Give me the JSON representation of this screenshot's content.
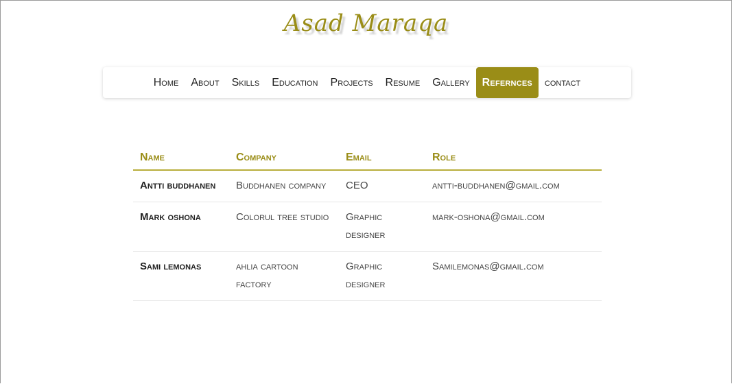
{
  "site": {
    "logo_text": "Asad Maraqa"
  },
  "nav": {
    "items": [
      {
        "label": "Home"
      },
      {
        "label": "About"
      },
      {
        "label": "Skills"
      },
      {
        "label": "Education"
      },
      {
        "label": "Projects"
      },
      {
        "label": "Resume"
      },
      {
        "label": "Gallery"
      },
      {
        "label": "Refernces",
        "active": true
      },
      {
        "label": "contact"
      }
    ]
  },
  "table": {
    "headers": [
      "Name",
      "Company",
      "Email",
      "Role"
    ],
    "rows": [
      [
        "Antti buddhanen",
        "Buddhanen company",
        "CEO",
        "antti-buddhanen@gmail.com"
      ],
      [
        "Mark oshona",
        "Colorul tree studio",
        "Graphic designer",
        "mark-oshona@gmail.com"
      ],
      [
        "Sami lemonas",
        "ahlia cartoon factory",
        "Graphic designer",
        "Samilemonas@gmail.com"
      ]
    ]
  },
  "colors": {
    "accent": "#9a8d17",
    "text": "#222222"
  }
}
